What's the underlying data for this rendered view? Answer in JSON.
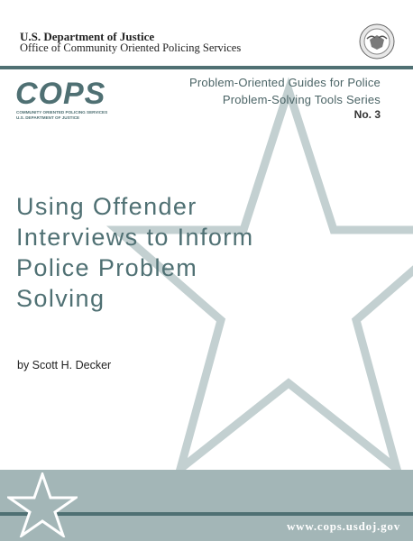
{
  "header": {
    "department": "U.S. Department of Justice",
    "office": "Office of Community Oriented Policing Services"
  },
  "logo": {
    "wordmark": "COPS",
    "subline1": "COMMUNITY ORIENTED POLICING SERVICES",
    "subline2": "U.S. DEPARTMENT OF JUSTICE"
  },
  "series": {
    "line1": "Problem-Oriented Guides for Police",
    "line2": "Problem-Solving Tools Series",
    "number": "No. 3"
  },
  "title_lines": [
    "Using Offender",
    "Interviews to Inform",
    "Police Problem",
    "Solving"
  ],
  "byline": "by  Scott H. Decker",
  "footer": {
    "url": "www.cops.usdoj.gov"
  },
  "colors": {
    "teal": "#4f7073",
    "footer_band": "#a3b6b7",
    "star_outline": "#c3d0d1"
  },
  "icons": [
    "doj-seal-icon",
    "star-icon"
  ]
}
